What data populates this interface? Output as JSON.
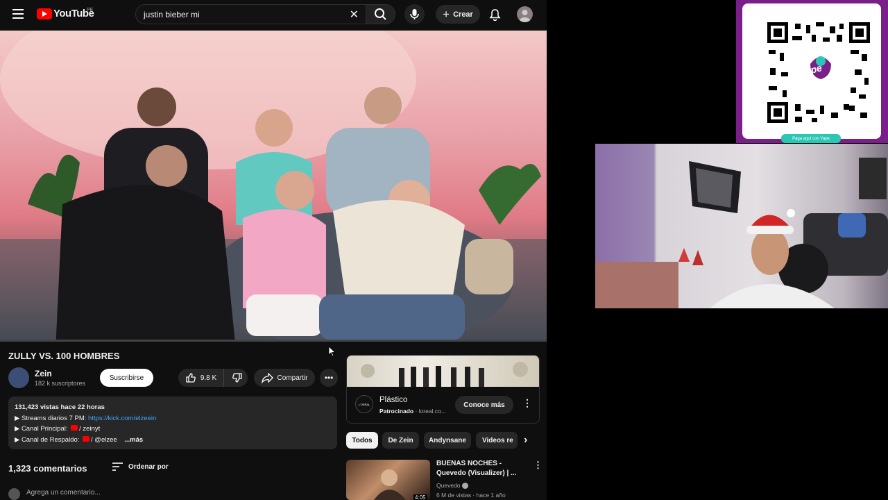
{
  "topbar": {
    "logo_text": "YouTube",
    "country_code": "PE",
    "search_value": "justin bieber mi",
    "create_label": "Crear"
  },
  "video": {
    "title": "ZULLY VS. 100 HOMBRES",
    "channel_name": "Zein",
    "subscribers": "182 k suscriptores",
    "subscribe_label": "Suscribirse",
    "likes": "9.8 K",
    "share_label": "Compartir"
  },
  "description": {
    "stats": "131,423 vistas  hace 22 horas",
    "line1_label": "▶ Streams diarios 7 PM:",
    "line1_link": "https://kick.com/elzeein",
    "line2_label": "▶ Canal Principal:",
    "line2_value": "/ zeinyt",
    "line3_label": "▶ Canal de Respaldo:",
    "line3_value": "/ @elzee",
    "more_label": "...más"
  },
  "comments": {
    "count_label": "1,323 comentarios",
    "sort_label": "Ordenar por",
    "add_placeholder": "Agrega un comentario..."
  },
  "ad": {
    "title": "Plástico",
    "sponsored_label": "Patrocinado",
    "domain": "loreal.co...",
    "cta_label": "Conoce más",
    "logo_text": "L'ORÉAL"
  },
  "chips": [
    "Todos",
    "De Zein",
    "Andynsane",
    "Videos re"
  ],
  "recommendation": {
    "title": "BUENAS NOCHES - Quevedo (Visualizer) | ...",
    "channel": "Quevedo",
    "meta": "6 M de vistas · hace 1 año",
    "duration": "4:05"
  },
  "overlay": {
    "qr_brand": "yape",
    "qr_caption": "Paga aquí con Yape"
  },
  "colors": {
    "background": "#0f0f0f",
    "youtube_red": "#ff0000",
    "link_blue": "#3ea6ff",
    "yape_purple": "#7a1f8a",
    "yape_teal": "#2bc7b5"
  }
}
